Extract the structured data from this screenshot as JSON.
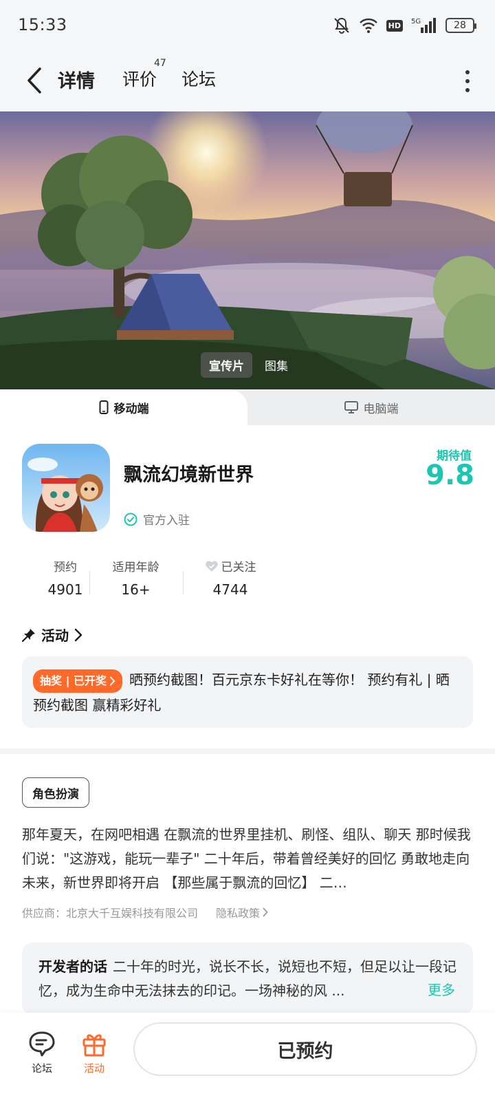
{
  "status_bar": {
    "time": "15:33",
    "network": "5G",
    "hd": "HD",
    "battery": "28"
  },
  "header": {
    "tabs": [
      {
        "label": "详情",
        "active": true
      },
      {
        "label": "评价",
        "count": "47"
      },
      {
        "label": "论坛"
      }
    ]
  },
  "banner": {
    "media_tabs": [
      {
        "label": "宣传片",
        "active": true
      },
      {
        "label": "图集"
      }
    ]
  },
  "platform_tabs": [
    {
      "label": "移动端",
      "active": true
    },
    {
      "label": "电脑端"
    }
  ],
  "app": {
    "name": "飘流幻境新世界",
    "official_label": "官方入驻",
    "expect_label": "期待值",
    "expect_score": "9.8"
  },
  "stats": [
    {
      "label": "预约",
      "value": "4901"
    },
    {
      "label": "适用年龄",
      "value": "16+"
    },
    {
      "label": "已关注",
      "value": "4744"
    }
  ],
  "activity": {
    "title": "活动",
    "badge": "抽奖 | 已开奖",
    "text": "晒预约截图！百元京东卡好礼在等你！ 预约有礼 | 晒预约截图 赢精彩好礼"
  },
  "detail": {
    "genre_tag": "角色扮演",
    "description": "那年夏天，在网吧相遇 在飘流的世界里挂机、刷怪、组队、聊天 那时候我们说：\"这游戏，能玩一辈子\" 二十年后，带着曾经美好的回忆 勇敢地走向未来，新世界即将开启 【那些属于飘流的回忆】 二…",
    "supplier": "供应商：北京大千互娱科技有限公司",
    "privacy": "隐私政策"
  },
  "developer": {
    "title": "开发者的话",
    "text": "二十年的时光，说长不长，说短也不短，但足以让一段记忆，成为生命中无法抹去的印记。一场神秘的风 ...",
    "more": "更多"
  },
  "bottom_bar": {
    "forum_label": "论坛",
    "activity_label": "活动",
    "reserve_label": "已预约"
  },
  "colors": {
    "accent": "#1cc7b2",
    "orange": "#ff6a2b"
  }
}
